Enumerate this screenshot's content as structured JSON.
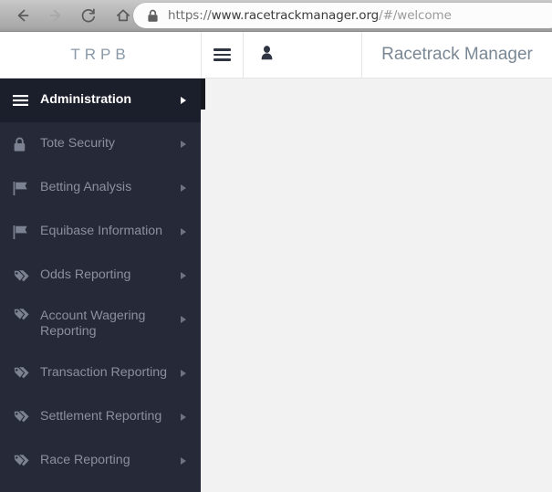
{
  "browser": {
    "back_icon": "back-arrow-icon",
    "forward_icon": "forward-arrow-icon",
    "reload_icon": "reload-icon",
    "home_icon": "home-icon",
    "lock_icon": "lock-icon",
    "url": {
      "scheme": "https://",
      "host": "www.racetrackmanager.org",
      "path": "/#/welcome",
      "full": "https://www.racetrackmanager.org/#/welcome"
    }
  },
  "navbar": {
    "brand": "TRPB",
    "menu_toggle_icon": "hamburger-menu-icon",
    "user_icon": "user-account-icon",
    "title": "Racetrack Manager"
  },
  "sidebar": {
    "items": [
      {
        "label": "Administration",
        "icon": "hamburger-menu-icon",
        "active": true,
        "arrow": "chevron-right-icon"
      },
      {
        "label": "Tote Security",
        "icon": "lock-icon",
        "active": false,
        "arrow": "chevron-right-icon"
      },
      {
        "label": "Betting Analysis",
        "icon": "flag-icon",
        "active": false,
        "arrow": "chevron-right-icon"
      },
      {
        "label": "Equibase Information",
        "icon": "flag-icon",
        "active": false,
        "arrow": "chevron-right-icon"
      },
      {
        "label": "Odds Reporting",
        "icon": "tags-icon",
        "active": false,
        "arrow": "chevron-right-icon"
      },
      {
        "label": "Account Wagering Reporting",
        "icon": "tags-icon",
        "active": false,
        "arrow": "chevron-right-icon"
      },
      {
        "label": "Transaction Reporting",
        "icon": "tags-icon",
        "active": false,
        "arrow": "chevron-right-icon"
      },
      {
        "label": "Settlement Reporting",
        "icon": "tags-icon",
        "active": false,
        "arrow": "chevron-right-icon"
      },
      {
        "label": "Race Reporting",
        "icon": "tags-icon",
        "active": false,
        "arrow": "chevron-right-icon"
      }
    ]
  },
  "colors": {
    "sidebar_bg": "#262a38",
    "sidebar_active_bg": "#1b1f2b",
    "sidebar_text": "#8b8f9e",
    "navbar_bg": "#ffffff",
    "brand_text": "#8a99a8",
    "title_text": "#7a8794",
    "content_bg": "#f2f2f3"
  }
}
